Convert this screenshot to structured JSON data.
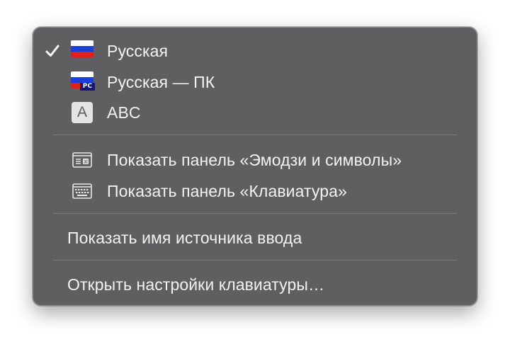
{
  "menu": {
    "input_sources": [
      {
        "label": "Русская",
        "icon": "russian-flag-icon",
        "selected": true
      },
      {
        "label": "Русская — ПК",
        "icon": "russian-pc-flag-icon",
        "badge": "PC",
        "selected": false
      },
      {
        "label": "ABC",
        "icon": "abc-icon",
        "icon_glyph": "A",
        "selected": false
      }
    ],
    "panels": [
      {
        "label": "Показать панель «Эмодзи и символы»",
        "icon": "emoji-viewer-icon"
      },
      {
        "label": "Показать панель «Клавиатура»",
        "icon": "keyboard-viewer-icon"
      }
    ],
    "show_input_source_name": "Показать имя источника ввода",
    "open_keyboard_settings": "Открыть настройки клавиатуры…"
  },
  "colors": {
    "menu_background": "#5f5f61",
    "text": "#f2f2f2",
    "separator": "#7b7b7d",
    "flag_white": "#ffffff",
    "flag_blue": "#1a40d8",
    "flag_red": "#e0201c",
    "pc_badge": "#15157a"
  }
}
